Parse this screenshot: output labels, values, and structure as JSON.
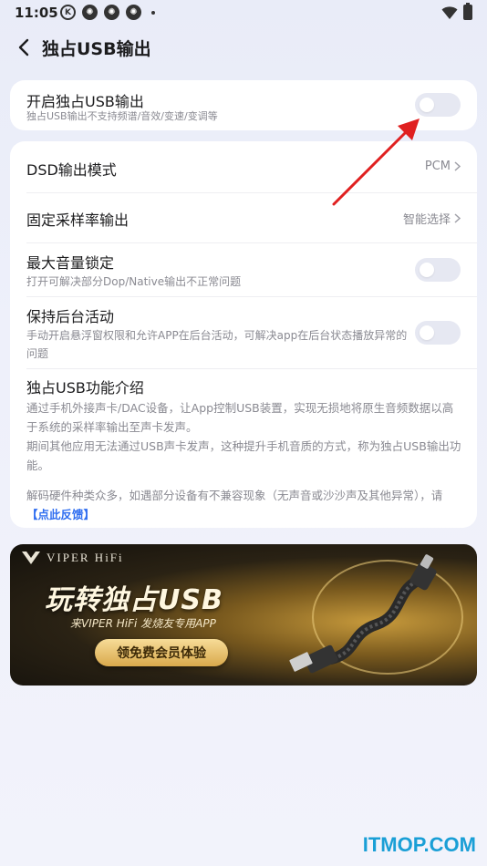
{
  "status_bar": {
    "time": "11:05",
    "icons": [
      "K",
      "✺",
      "✺",
      "✺"
    ]
  },
  "header": {
    "title": "独占USB输出",
    "back_icon": "chevron-left-icon"
  },
  "exclusive_usb": {
    "title": "开启独占USB输出",
    "subtitle": "独占USB输出不支持频谱/音效/变速/变调等",
    "enabled": false
  },
  "settings": {
    "dsd": {
      "title": "DSD输出模式",
      "value": "PCM"
    },
    "sample_rate": {
      "title": "固定采样率输出",
      "value": "智能选择"
    },
    "max_volume": {
      "title": "最大音量锁定",
      "subtitle": "打开可解决部分Dop/Native输出不正常问题",
      "enabled": false
    },
    "background": {
      "title": "保持后台活动",
      "subtitle": "手动开启悬浮窗权限和允许APP在后台活动，可解决app在后台状态播放异常的问题",
      "enabled": false
    },
    "intro": {
      "title": "独占USB功能介绍",
      "para1": "通过手机外接声卡/DAC设备，让App控制USB装置，实现无损地将原生音频数据以高于系统的采样率输出至声卡发声。",
      "para2": "期间其他应用无法通过USB声卡发声，这种提升手机音质的方式，称为独占USB输出功能。",
      "para3": "解码硬件种类众多，如遇部分设备有不兼容现象（无声音或沙沙声及其他异常），请",
      "feedback_link": "【点此反馈】"
    }
  },
  "banner": {
    "brand": "VIPER HiFi",
    "heading": "玩转独占USB",
    "subline": "来VIPER HiFi 发烧友专用APP",
    "cta": "领免费会员体验"
  },
  "watermark": "ITMOP.COM",
  "colors": {
    "link": "#2f6ef0",
    "toggle_off": "#e6e8f2",
    "annotation_arrow": "#e02020",
    "banner_gold": "#d9a94c"
  }
}
